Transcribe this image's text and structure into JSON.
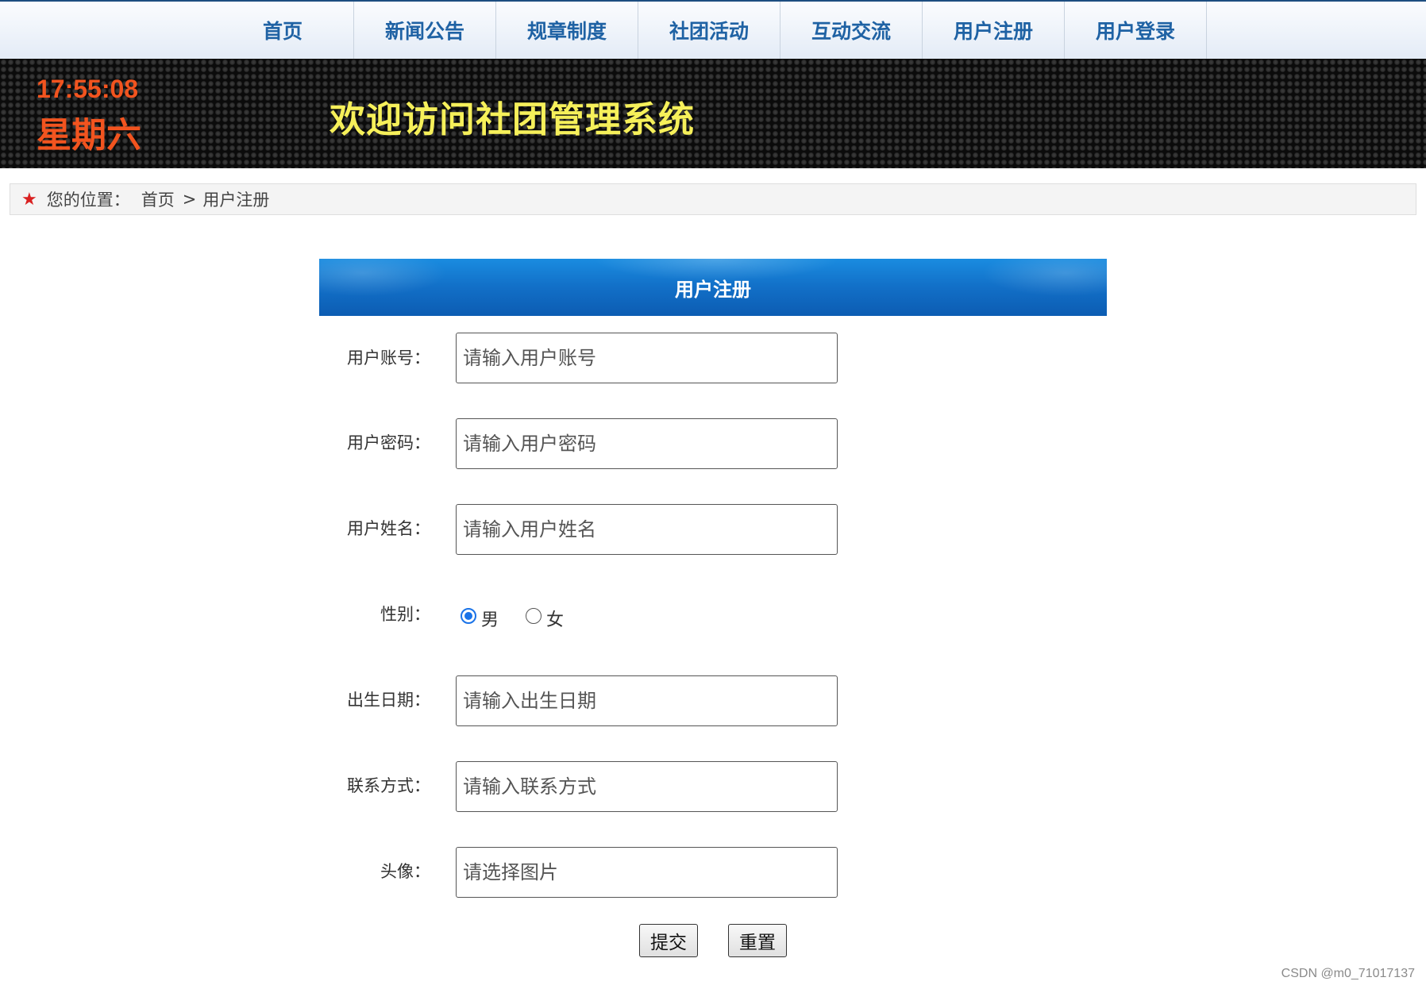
{
  "nav": {
    "items": [
      {
        "label": "首页"
      },
      {
        "label": "新闻公告"
      },
      {
        "label": "规章制度"
      },
      {
        "label": "社团活动"
      },
      {
        "label": "互动交流"
      },
      {
        "label": "用户注册"
      },
      {
        "label": "用户登录"
      }
    ]
  },
  "banner": {
    "time": "17:55:08",
    "weekday": "星期六",
    "welcome": "欢迎访问社团管理系统"
  },
  "breadcrumb": {
    "prefix": "您的位置：",
    "home": "首页",
    "separator": ">",
    "current": "用户注册",
    "icon": "star-icon"
  },
  "form": {
    "title": "用户注册",
    "fields": {
      "account": {
        "label": "用户账号：",
        "placeholder": "请输入用户账号"
      },
      "password": {
        "label": "用户密码：",
        "placeholder": "请输入用户密码"
      },
      "name": {
        "label": "用户姓名：",
        "placeholder": "请输入用户姓名"
      },
      "birthday": {
        "label": "出生日期：",
        "placeholder": "请输入出生日期"
      },
      "contact": {
        "label": "联系方式：",
        "placeholder": "请输入联系方式"
      },
      "avatar": {
        "label": "头像：",
        "placeholder": "请选择图片"
      }
    },
    "gender": {
      "label": "性别：",
      "options": [
        {
          "label": "男",
          "checked": true
        },
        {
          "label": "女",
          "checked": false
        }
      ]
    },
    "buttons": {
      "submit": "提交",
      "reset": "重置"
    }
  },
  "watermark": "CSDN @m0_71017137",
  "colors": {
    "nav_text": "#1f62a4",
    "clock": "#f2541f",
    "welcome": "#f6f05a",
    "header_blue": "#1270c8",
    "breadcrumb_star": "#d92020",
    "radio_selected": "#1a73e8"
  }
}
